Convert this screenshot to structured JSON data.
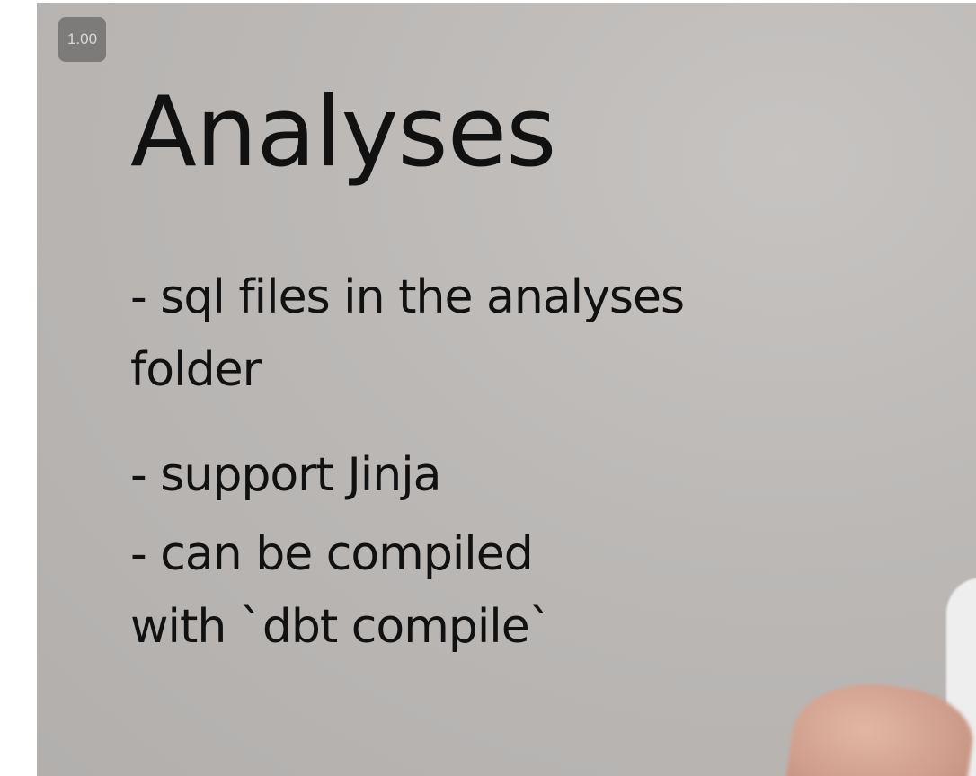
{
  "player": {
    "playback_speed": "1.00"
  },
  "slide": {
    "title": "Analyses",
    "bullets": [
      {
        "lines": [
          "- sql files in the analyses",
          "folder"
        ]
      },
      {
        "lines": [
          "- support Jinja"
        ]
      },
      {
        "lines": [
          "- can be compiled",
          "with `dbt compile`"
        ]
      }
    ]
  }
}
